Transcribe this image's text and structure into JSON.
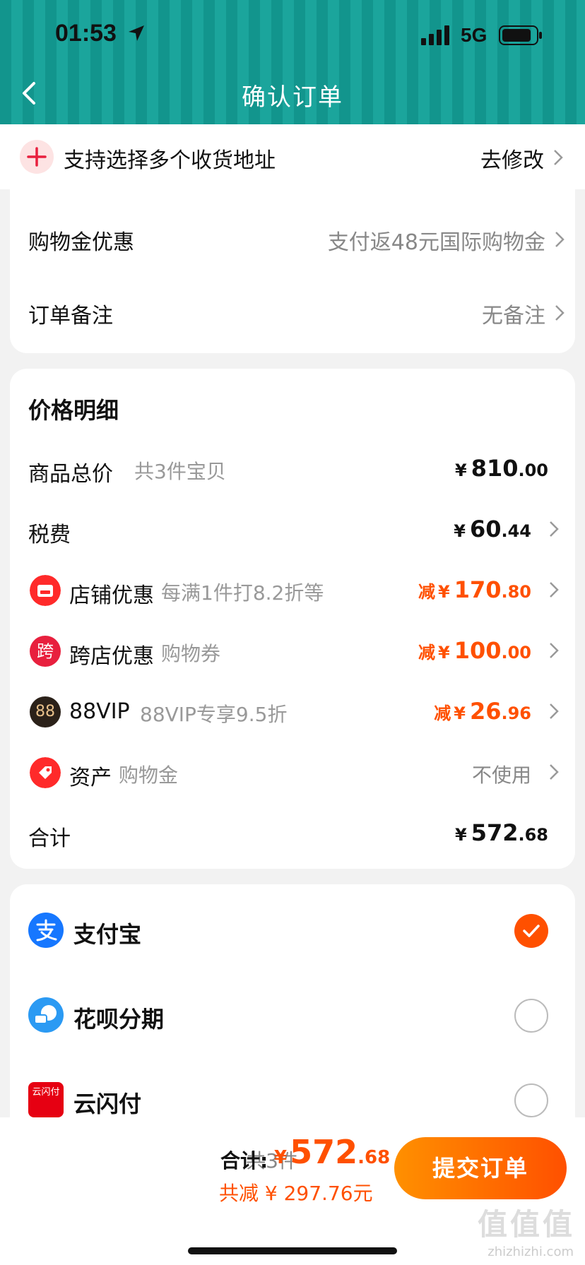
{
  "status_bar": {
    "time": "01:53",
    "network": "5G"
  },
  "nav": {
    "title": "确认订单"
  },
  "address_bar": {
    "text": "支持选择多个收货地址",
    "action": "去修改"
  },
  "order_options": {
    "items": [
      {
        "label": "购物金优惠",
        "value": "支付返48元国际购物金"
      },
      {
        "label": "订单备注",
        "value": "无备注"
      }
    ]
  },
  "price_detail": {
    "title": "价格明细",
    "goods_total": {
      "label": "商品总价",
      "sub": "共3件宝贝",
      "currency": "¥",
      "int": "810",
      "dec": ".00"
    },
    "tax": {
      "label": "税费",
      "currency": "¥",
      "int": "60",
      "dec": ".44"
    },
    "store_discount": {
      "label": "店铺优惠",
      "sub": "每满1件打8.2折等",
      "prefix": "减",
      "currency": "¥",
      "int": "170",
      "dec": ".80",
      "icon_color": "#ff2a2a"
    },
    "cross_store": {
      "label": "跨店优惠",
      "sub": "购物券",
      "prefix": "减",
      "currency": "¥",
      "int": "100",
      "dec": ".00",
      "icon_text": "跨",
      "icon_color": "#e8203e"
    },
    "vip": {
      "label": "88VIP",
      "sub": "88VIP专享9.5折",
      "prefix": "减",
      "currency": "¥",
      "int": "26",
      "dec": ".96",
      "icon_text": "88",
      "icon_color": "#2b2119"
    },
    "assets": {
      "label": "资产",
      "sub": "购物金",
      "value": "不使用",
      "icon_color": "#ff2a2a"
    },
    "total": {
      "label": "合计",
      "currency": "¥",
      "int": "572",
      "dec": ".68"
    }
  },
  "payment": {
    "options": [
      {
        "label": "支付宝",
        "selected": true,
        "icon": "alipay-icon"
      },
      {
        "label": "花呗分期",
        "selected": false,
        "icon": "huabei-icon"
      },
      {
        "label": "云闪付",
        "selected": false,
        "icon": "unionpay-icon",
        "icon_text": "云闪付"
      }
    ]
  },
  "bottom_bar": {
    "count": "共3件",
    "total_label": "合计:",
    "currency": "¥",
    "total_int": "572",
    "total_dec": ".68",
    "saved": "共减 ¥ 297.76元",
    "submit": "提交订单",
    "watermark": "值值值",
    "watermark_url": "zhizhizhi.com"
  },
  "colors": {
    "accent": "#ff5000",
    "header": "#12958d"
  }
}
